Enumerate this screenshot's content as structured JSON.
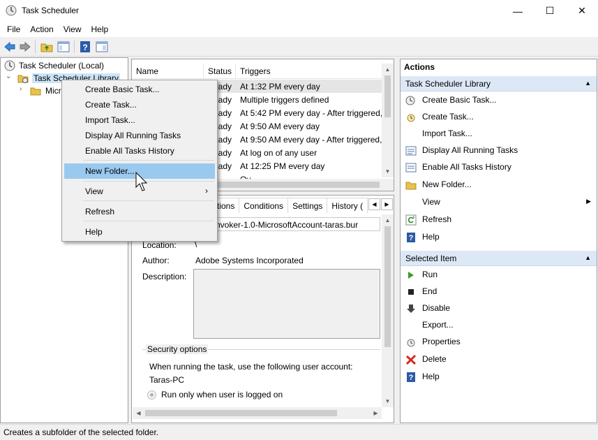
{
  "window": {
    "title": "Task Scheduler",
    "minimize": "—",
    "maximize": "☐",
    "close": "✕"
  },
  "menu": [
    "File",
    "Action",
    "View",
    "Help"
  ],
  "tree": {
    "root": "Task Scheduler (Local)",
    "library": "Task Scheduler Library",
    "child": "Micr"
  },
  "task_list": {
    "columns": [
      "Name",
      "Status",
      "Triggers"
    ],
    "rows": [
      {
        "status": "ady",
        "trigger": "At 1:32 PM every day"
      },
      {
        "status": "ady",
        "trigger": "Multiple triggers defined"
      },
      {
        "status": "ady",
        "trigger": "At 5:42 PM every day - After triggered,"
      },
      {
        "status": "ady",
        "trigger": "At 9:50 AM every day"
      },
      {
        "status": "ady",
        "trigger": "At 9:50 AM every day - After triggered,"
      },
      {
        "status": "ady",
        "trigger": "At log on of any user"
      },
      {
        "status": "ady",
        "trigger": "At 12:25 PM every day"
      },
      {
        "status": "",
        "trigger": "Ov..."
      }
    ]
  },
  "details": {
    "tabs": [
      "ctions",
      "Conditions",
      "Settings",
      "History ("
    ],
    "name_value": "eGCInvoker-1.0-MicrosoftAccount-taras.bur",
    "location_label": "Location:",
    "location_value": "\\",
    "author_label": "Author:",
    "author_value": "Adobe Systems Incorporated",
    "description_label": "Description:",
    "security_title": "Security options",
    "security_text": "When running the task, use the following user account:",
    "account": "Taras-PC",
    "radio_label": "Run only when user is logged on"
  },
  "actions": {
    "header": "Actions",
    "library_section": "Task Scheduler Library",
    "library_items": [
      {
        "label": "Create Basic Task...",
        "icon": "create-basic-task-icon"
      },
      {
        "label": "Create Task...",
        "icon": "create-task-icon"
      },
      {
        "label": "Import Task...",
        "icon": ""
      },
      {
        "label": "Display All Running Tasks",
        "icon": "running-tasks-icon"
      },
      {
        "label": "Enable All Tasks History",
        "icon": "tasks-history-icon"
      },
      {
        "label": "New Folder...",
        "icon": "folder-icon"
      },
      {
        "label": "View",
        "icon": ""
      },
      {
        "label": "Refresh",
        "icon": "refresh-icon"
      },
      {
        "label": "Help",
        "icon": "help-icon"
      }
    ],
    "selected_section": "Selected Item",
    "selected_items": [
      {
        "label": "Run",
        "icon": "run-icon"
      },
      {
        "label": "End",
        "icon": "end-icon"
      },
      {
        "label": "Disable",
        "icon": "disable-icon"
      },
      {
        "label": "Export...",
        "icon": ""
      },
      {
        "label": "Properties",
        "icon": "properties-icon"
      },
      {
        "label": "Delete",
        "icon": "delete-icon"
      },
      {
        "label": "Help",
        "icon": "help-icon"
      }
    ]
  },
  "context_menu": {
    "items": [
      "Create Basic Task...",
      "Create Task...",
      "Import Task...",
      "Display All Running Tasks",
      "Enable All Tasks History",
      "New Folder...",
      "View",
      "Refresh",
      "Help"
    ],
    "highlighted": "New Folder..."
  },
  "status_bar": "Creates a subfolder of the selected folder.",
  "colors": {
    "highlight": "#99c9ef",
    "section_header": "#dde8f6",
    "help_blue": "#2b5aa8",
    "run_green": "#3a9b28",
    "delete_red": "#d42b1e"
  }
}
